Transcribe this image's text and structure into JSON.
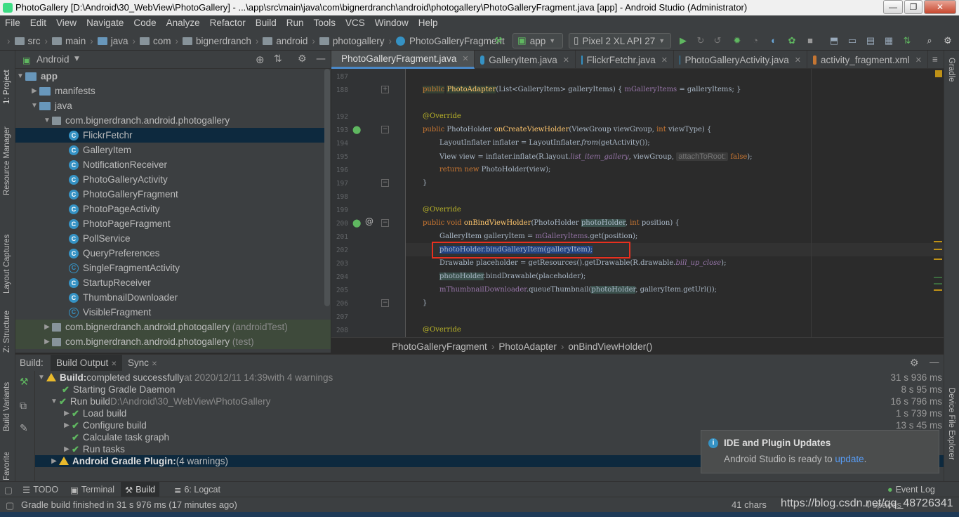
{
  "window": {
    "title": "PhotoGallery [D:\\Android\\30_WebView\\PhotoGallery] - ...\\app\\src\\main\\java\\com\\bignerdranch\\android\\photogallery\\PhotoGalleryFragment.java [app] - Android Studio (Administrator)",
    "minimize": "—",
    "maximize": "❐",
    "close": "✕"
  },
  "menu": [
    "File",
    "Edit",
    "View",
    "Navigate",
    "Code",
    "Analyze",
    "Refactor",
    "Build",
    "Run",
    "Tools",
    "VCS",
    "Window",
    "Help"
  ],
  "nav": {
    "crumbs": [
      "src",
      "main",
      "java",
      "com",
      "bignerdranch",
      "android",
      "photogallery",
      "PhotoGalleryFragment"
    ],
    "config": "app",
    "device": "Pixel 2 XL API 27"
  },
  "left_strip": [
    "1: Project",
    "Resource Manager",
    "Layout Captures",
    "Z: Structure",
    "Build Variants",
    "Favorites"
  ],
  "right_strip": [
    "Gradle",
    "Device File Explorer"
  ],
  "project": {
    "view": "Android",
    "tree": [
      {
        "label": "app",
        "kind": "folder-blue",
        "depth": 0,
        "arrow": "▼"
      },
      {
        "label": "manifests",
        "kind": "folder",
        "depth": 1,
        "arrow": "▶"
      },
      {
        "label": "java",
        "kind": "folder",
        "depth": 1,
        "arrow": "▼"
      },
      {
        "label": "com.bignerdranch.android.photogallery",
        "kind": "package",
        "depth": 2,
        "arrow": "▼"
      },
      {
        "label": "FlickrFetchr",
        "kind": "class",
        "depth": 3,
        "selected": true
      },
      {
        "label": "GalleryItem",
        "kind": "class",
        "depth": 3
      },
      {
        "label": "NotificationReceiver",
        "kind": "class",
        "depth": 3
      },
      {
        "label": "PhotoGalleryActivity",
        "kind": "class",
        "depth": 3
      },
      {
        "label": "PhotoGalleryFragment",
        "kind": "class",
        "depth": 3
      },
      {
        "label": "PhotoPageActivity",
        "kind": "class",
        "depth": 3
      },
      {
        "label": "PhotoPageFragment",
        "kind": "class",
        "depth": 3
      },
      {
        "label": "PollService",
        "kind": "class",
        "depth": 3
      },
      {
        "label": "QueryPreferences",
        "kind": "class",
        "depth": 3
      },
      {
        "label": "SingleFragmentActivity",
        "kind": "abstract",
        "depth": 3
      },
      {
        "label": "StartupReceiver",
        "kind": "class",
        "depth": 3
      },
      {
        "label": "ThumbnailDownloader",
        "kind": "class",
        "depth": 3
      },
      {
        "label": "VisibleFragment",
        "kind": "abstract",
        "depth": 3
      },
      {
        "label": "com.bignerdranch.android.photogallery",
        "suffix": "(androidTest)",
        "kind": "package",
        "depth": 2,
        "arrow": "▶",
        "green": true
      },
      {
        "label": "com.bignerdranch.android.photogallery",
        "suffix": "(test)",
        "kind": "package",
        "depth": 2,
        "arrow": "▶",
        "green": true
      }
    ]
  },
  "tabs": [
    {
      "label": "PhotoGalleryFragment.java",
      "active": true,
      "icon": "class"
    },
    {
      "label": "GalleryItem.java",
      "icon": "class"
    },
    {
      "label": "FlickrFetchr.java",
      "icon": "class"
    },
    {
      "label": "PhotoGalleryActivity.java",
      "icon": "class"
    },
    {
      "label": "activity_fragment.xml",
      "icon": "xml"
    }
  ],
  "editor": {
    "line_numbers": [
      "187",
      "188",
      "",
      "192",
      "193",
      "194",
      "195",
      "196",
      "197",
      "198",
      "199",
      "200",
      "201",
      "202",
      "203",
      "204",
      "205",
      "206",
      "207",
      "208"
    ],
    "code": {
      "l188_a": "public",
      "l188_b": "PhotoAdapter",
      "l188_c": "(List<GalleryItem> galleryItems) { ",
      "l188_d": "mGalleryItems",
      "l188_e": " = galleryItems; }",
      "override": "@Override",
      "l193_a": "public ",
      "l193_b": "PhotoHolder ",
      "l193_c": "onCreateViewHolder",
      "l193_d": "(ViewGroup viewGroup, ",
      "l193_e": "int",
      "l193_f": " viewType) {",
      "l194_a": "LayoutInflater inflater = LayoutInflater.",
      "l194_b": "from",
      "l194_c": "(getActivity());",
      "l195_a": "View view = inflater.inflate(R.layout.",
      "l195_b": "list_item_gallery",
      "l195_c": ", viewGroup, ",
      "l195_hint": "attachToRoot:",
      "l195_d": "false",
      "l195_e": ");",
      "l196_a": "return new ",
      "l196_b": "PhotoHolder(view);",
      "close": "}",
      "l200_a": "public void ",
      "l200_b": "onBindViewHolder",
      "l200_c": "(PhotoHolder ",
      "l200_d": "photoHolder",
      "l200_e": ", ",
      "l200_f": "int",
      "l200_g": " position) {",
      "l201_a": "GalleryItem galleryItem = ",
      "l201_b": "mGalleryItems",
      "l201_c": ".get(position);",
      "l202": "photoHolder.bindGalleryItem(galleryItem);",
      "l203_a": "Drawable placeholder = getResources().getDrawable(R.drawable.",
      "l203_b": "bill_up_close",
      "l203_c": ");",
      "l204_a": "photoHolder",
      "l204_b": ".bindDrawable(placeholder);",
      "l205_a": "mThumbnailDownloader",
      "l205_b": ".queueThumbnail(",
      "l205_c": "photoHolder",
      "l205_d": ", galleryItem.getUrl());"
    },
    "breadcrumb": [
      "PhotoGalleryFragment",
      "PhotoAdapter",
      "onBindViewHolder()"
    ]
  },
  "build": {
    "tabs": [
      "Build:",
      "Build Output",
      "Sync"
    ],
    "rows": [
      {
        "bold": "Build:",
        "text": " completed successfully",
        "dim": " at 2020/12/11 14:39",
        "extra": "  with 4 warnings",
        "time": "31 s 936 ms",
        "icon": "warn",
        "depth": 0,
        "arrow": "▼"
      },
      {
        "text": "Starting Gradle Daemon",
        "time": "8 s 95 ms",
        "icon": "ok",
        "depth": 1
      },
      {
        "text": "Run build",
        "dim": " D:\\Android\\30_WebView\\PhotoGallery",
        "time": "16 s 796 ms",
        "icon": "ok",
        "depth": 1,
        "arrow": "▼"
      },
      {
        "text": "Load build",
        "time": "1 s 739 ms",
        "icon": "ok",
        "depth": 2,
        "arrow": "▶"
      },
      {
        "text": "Configure build",
        "time": "13 s 45 ms",
        "icon": "ok",
        "depth": 2,
        "arrow": "▶"
      },
      {
        "text": "Calculate task graph",
        "time": "",
        "icon": "ok",
        "depth": 2
      },
      {
        "text": "Run tasks",
        "time": "",
        "icon": "ok",
        "depth": 2,
        "arrow": "▶"
      },
      {
        "bold": "Android Gradle Plugin:",
        "text": "",
        "extra": " (4 warnings)",
        "time": "",
        "icon": "warn",
        "depth": 0,
        "arrow": "▶",
        "selected": true
      }
    ]
  },
  "notification": {
    "title": "IDE and Plugin Updates",
    "body": "Android Studio is ready to ",
    "link": "update",
    "end": "."
  },
  "bottom_tabs": [
    "TODO",
    "Terminal",
    "Build",
    "6: Logcat"
  ],
  "event_log": "Event Log",
  "status": {
    "message": "Gradle build finished in 31 s 976 ms (17 minutes ago)",
    "chars": "41 chars",
    "watermark": "https://blog.csdn.net/qq_48726341",
    "spaces": "4 spaces"
  }
}
